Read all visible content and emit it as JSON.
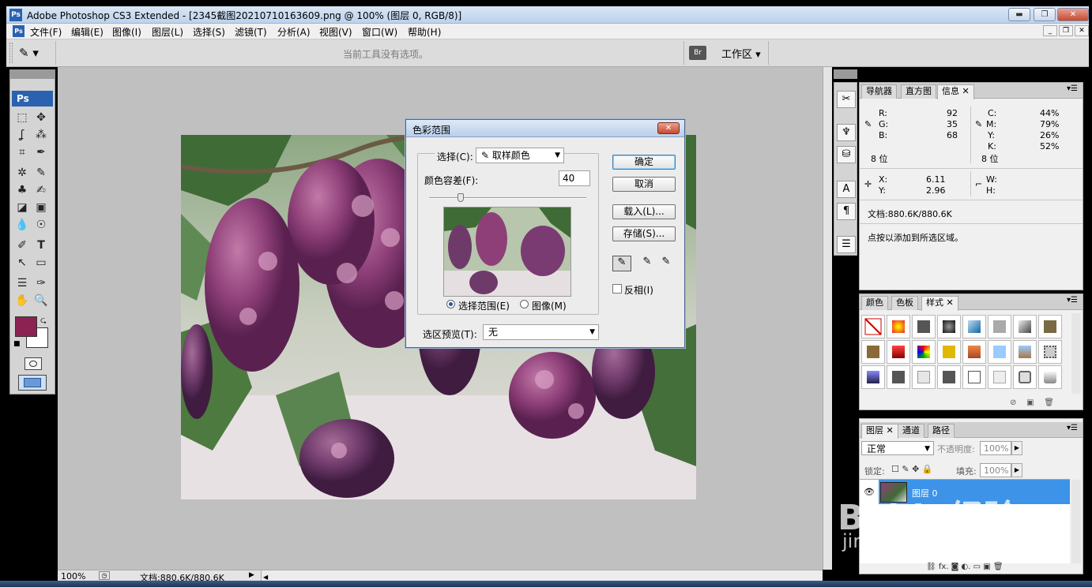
{
  "app": {
    "title": "Adobe Photoshop CS3 Extended - [2345截图20210710163609.png @ 100% (图层 0, RGB/8)]",
    "logo": "Ps"
  },
  "window_controls": {
    "minimize": "▬",
    "restore": "❐",
    "close": "✕"
  },
  "menu": [
    "文件(F)",
    "编辑(E)",
    "图像(I)",
    "图层(L)",
    "选择(S)",
    "滤镜(T)",
    "分析(A)",
    "视图(V)",
    "窗口(W)",
    "帮助(H)"
  ],
  "options": {
    "message": "当前工具没有选项。",
    "workspace": "工作区 ▾"
  },
  "toolbox": {
    "logo": "Ps",
    "tools": [
      [
        "⬚",
        "✥"
      ],
      [
        "ʆ",
        "⁂"
      ],
      [
        "⌗",
        "✒"
      ],
      [
        "✲",
        "✎"
      ],
      [
        "♣",
        "✍"
      ],
      [
        "◪",
        "▣"
      ],
      [
        "💧",
        "☉"
      ],
      [
        "✐",
        "T"
      ],
      [
        "↖",
        "▭"
      ],
      [
        "☰",
        "✑"
      ],
      [
        "✋",
        "🔍"
      ]
    ],
    "fg": "#8b2252",
    "bg": "#ffffff"
  },
  "dialog": {
    "title": "色彩范围",
    "select_label": "选择(C):",
    "select_value": "取样颜色",
    "fuzziness_label": "颜色容差(F):",
    "fuzziness_value": "40",
    "fuzziness_fraction": 0.2,
    "ok": "确定",
    "cancel": "取消",
    "load": "载入(L)...",
    "save": "存储(S)...",
    "invert": "反相(I)",
    "radio_selection": "选择范围(E)",
    "radio_image": "图像(M)",
    "preview_label": "选区预览(T):",
    "preview_value": "无"
  },
  "panels": {
    "info_tabs": [
      "导航器",
      "直方图",
      "信息"
    ],
    "info": {
      "R": "92",
      "G": "35",
      "B": "68",
      "C": "44%",
      "M": "79%",
      "Y": "26%",
      "K": "52%",
      "bits_left": "8 位",
      "bits_right": "8 位",
      "X": "6.11",
      "Y2": "2.96",
      "W": "",
      "H": "",
      "doc": "文档:880.6K/880.6K",
      "tip": "点按以添加到所选区域。"
    },
    "style_tabs": [
      "颜色",
      "色板",
      "样式"
    ],
    "layer_tabs": [
      "图层",
      "通道",
      "路径"
    ],
    "layers": {
      "blend": "正常",
      "opacity_label": "不透明度:",
      "opacity": "100%",
      "lock_label": "锁定:",
      "fill_label": "填充:",
      "fill": "100%",
      "layer_name": "图层 0",
      "footer": "⛓  fx. ◙ ◐. ▭ ▣ 🗑"
    }
  },
  "status": {
    "zoom": "100%",
    "doc": "文档:880.6K/880.6K"
  },
  "watermark": {
    "brand": "Baidu经验",
    "url": "jingyan.baidu.com"
  }
}
